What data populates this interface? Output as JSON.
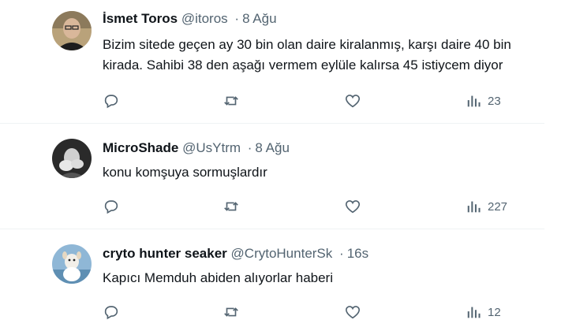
{
  "tweets": [
    {
      "name": "İsmet Toros",
      "handle": "@itoros",
      "time": "8 Ağu",
      "text": "Bizim sitede geçen ay 30 bin olan daire kiralanmış, karşı daire 40 bin kirada. Sahibi 38 den aşağı vermem eylüle kalırsa 45 istiycem diyor",
      "views": "23"
    },
    {
      "name": "MicroShade",
      "handle": "@UsYtrm",
      "time": "8 Ağu",
      "text": "konu komşuya sormuşlardır",
      "views": "227"
    },
    {
      "name": "cryto hunter seaker",
      "handle": "@CrytoHunterSk",
      "time": "16s",
      "text": "Kapıcı Memduh abiden alıyorlar haberi",
      "views": "12"
    }
  ],
  "dot": "·",
  "icons": [
    "reply-icon",
    "retweet-icon",
    "like-icon",
    "views-icon"
  ]
}
